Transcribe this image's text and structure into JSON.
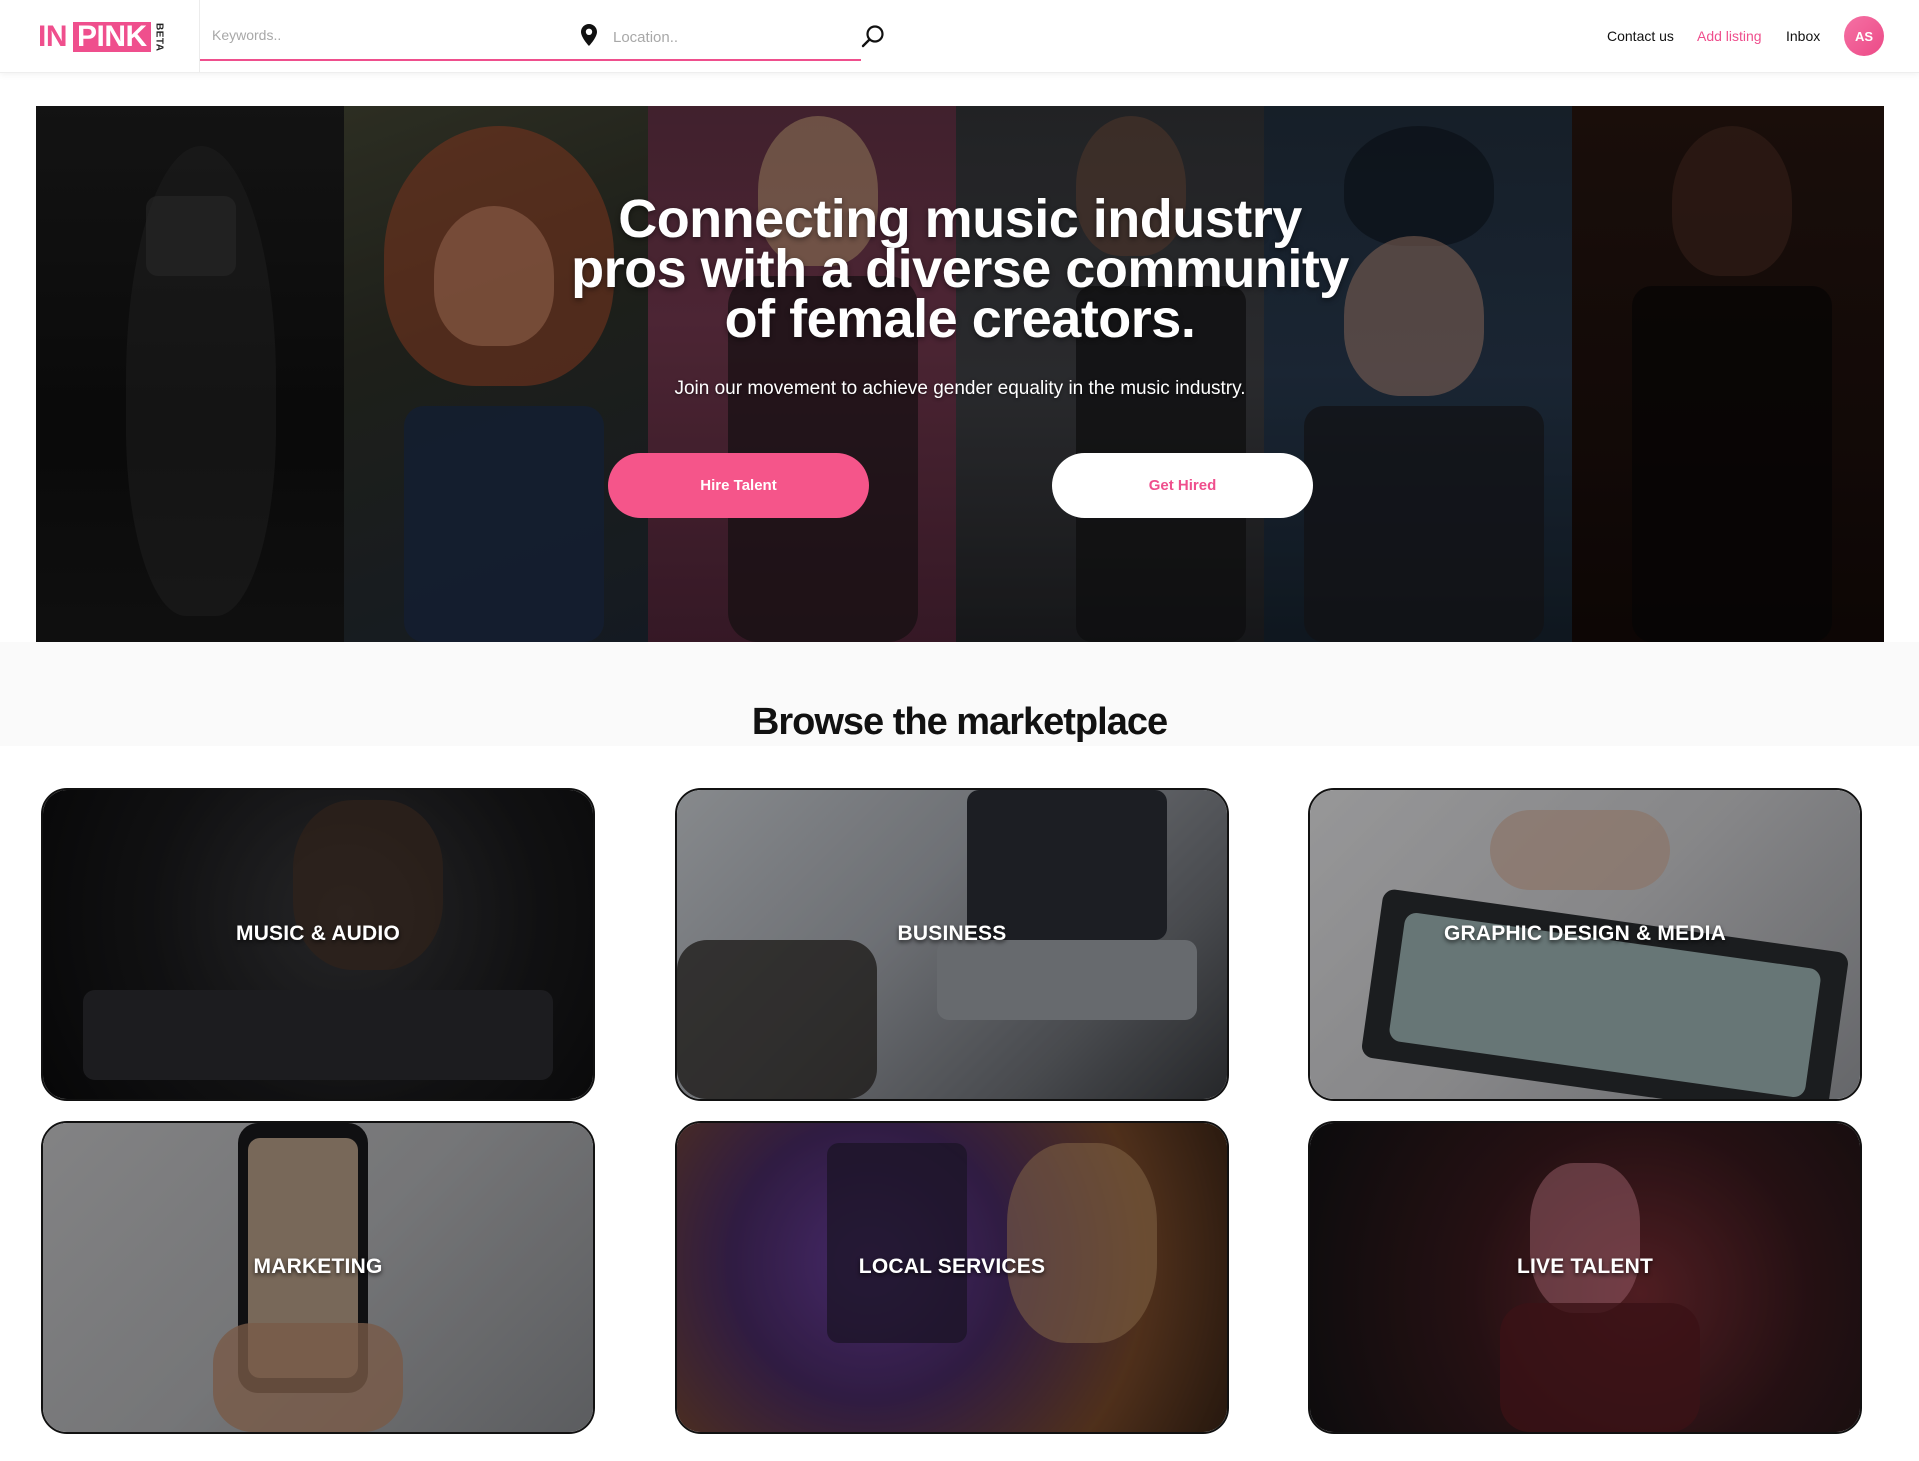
{
  "brand": {
    "logo_in": "IN",
    "logo_pink": "PINK",
    "logo_beta": "BETA",
    "accent_color": "#ef4f8d"
  },
  "search": {
    "keywords_placeholder": "Keywords..",
    "location_placeholder": "Location..",
    "location_icon": "map-pin-icon",
    "search_icon": "search-icon"
  },
  "nav": {
    "contact": "Contact us",
    "add_listing": "Add listing",
    "inbox": "Inbox",
    "avatar_initials": "AS"
  },
  "hero": {
    "title_lines": [
      "Connecting music industry",
      "pros with a diverse community",
      "of female creators."
    ],
    "subtitle": "Join our movement to achieve gender equality in the music industry.",
    "hire_button": "Hire Talent",
    "get_hired_button": "Get Hired"
  },
  "browse": {
    "title": "Browse the marketplace",
    "categories": [
      {
        "label": "MUSIC & AUDIO"
      },
      {
        "label": "BUSINESS"
      },
      {
        "label": "GRAPHIC DESIGN & MEDIA"
      },
      {
        "label": "MARKETING"
      },
      {
        "label": "LOCAL SERVICES"
      },
      {
        "label": "LIVE TALENT"
      }
    ]
  }
}
